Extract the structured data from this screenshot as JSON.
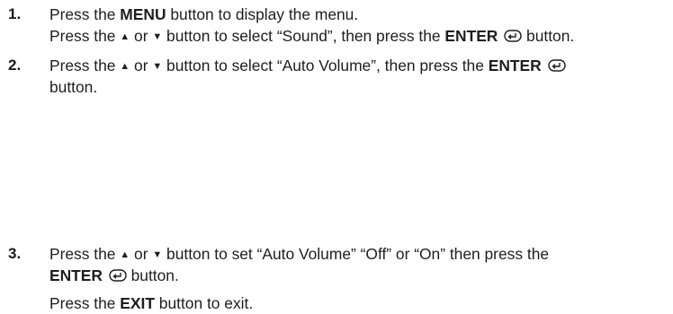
{
  "steps": [
    {
      "number": "1.",
      "lines": [
        {
          "pre": "Press the ",
          "bold": "MENU",
          "post": " button to display the menu."
        },
        {
          "pre": "Press the ",
          "up": "▲",
          "mid": " or ",
          "down": "▼",
          "post": " button to select “Sound”, then press the ",
          "bold": "ENTER",
          "end": " button."
        }
      ]
    },
    {
      "number": "2.",
      "lines": [
        {
          "pre": "Press the ",
          "up": "▲",
          "mid": " or ",
          "down": "▼",
          "post": " button to select “Auto Volume”, then press the ",
          "bold": "ENTER"
        },
        {
          "text": "button."
        }
      ]
    },
    {
      "number": "3.",
      "lines": [
        {
          "pre": "Press the ",
          "up": "▲",
          "mid": " or ",
          "down": "▼",
          "post": " button to set “Auto Volume” “Off” or “On” then press the"
        },
        {
          "bold": "ENTER",
          "end": " button."
        },
        {
          "pre": "Press the ",
          "bold": "EXIT",
          "post": " button to exit."
        }
      ]
    }
  ],
  "icons": {
    "enter": "enter-return-icon",
    "up": "up-triangle-icon",
    "down": "down-triangle-icon"
  }
}
